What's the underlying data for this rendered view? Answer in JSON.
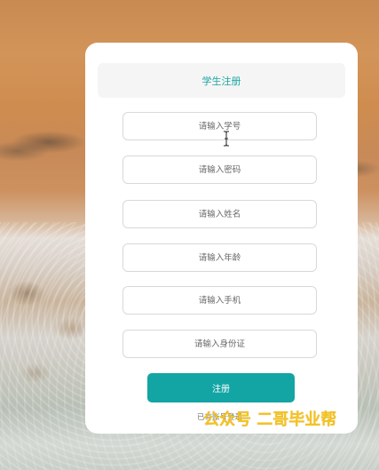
{
  "form": {
    "title": "学生注册",
    "fields": [
      {
        "placeholder": "请输入学号"
      },
      {
        "placeholder": "请输入密码"
      },
      {
        "placeholder": "请输入姓名"
      },
      {
        "placeholder": "请输入年龄"
      },
      {
        "placeholder": "请输入手机"
      },
      {
        "placeholder": "请输入身份证"
      }
    ],
    "submit_label": "注册",
    "login_link": "已有账号登录"
  },
  "watermark": {
    "text": "公众号 二哥毕业帮",
    "color": "#f6c21a"
  },
  "colors": {
    "accent": "#13a5a4",
    "title": "#1aa6a2"
  },
  "icons": {
    "cursor": "text-cursor-icon"
  }
}
